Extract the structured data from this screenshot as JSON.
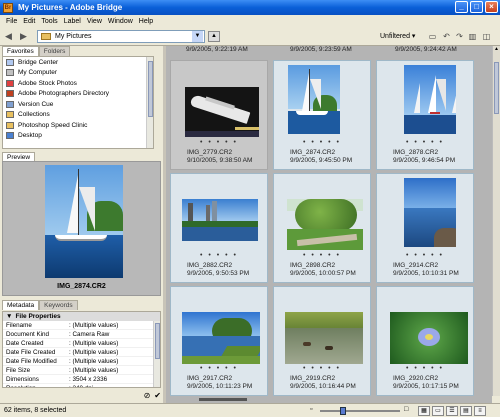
{
  "window": {
    "title": "My Pictures - Adobe Bridge",
    "controls": [
      "_",
      "□",
      "×"
    ]
  },
  "menu": [
    "File",
    "Edit",
    "Tools",
    "Label",
    "View",
    "Window",
    "Help"
  ],
  "toolbar": {
    "path": "My Pictures",
    "filter": "Unfiltered ▾"
  },
  "panels": {
    "favorites_tabs": [
      "Favorites",
      "Folders"
    ],
    "favorites": [
      {
        "label": "Bridge Center",
        "color": "#b0c8f0"
      },
      {
        "label": "My Computer",
        "color": "#c0c0c0"
      },
      {
        "label": "Adobe Stock Photos",
        "color": "#e04040"
      },
      {
        "label": "Adobe Photographers Directory",
        "color": "#c04020"
      },
      {
        "label": "Version Cue",
        "color": "#80a0d0"
      },
      {
        "label": "Collections",
        "color": "#e8c060"
      },
      {
        "label": "Photoshop Speed Clinic",
        "color": "#e8c060"
      },
      {
        "label": "Desktop",
        "color": "#4a80d0"
      }
    ],
    "preview_tab": "Preview",
    "preview_caption": "IMG_2874.CR2",
    "metadata_tabs": [
      "Metadata",
      "Keywords"
    ],
    "metadata_section": "File Properties",
    "metadata": [
      {
        "key": "Filename",
        "value": ": (Multiple values)"
      },
      {
        "key": "Document Kind",
        "value": ": Camera Raw"
      },
      {
        "key": "Date Created",
        "value": ": (Multiple values)"
      },
      {
        "key": "Date File Created",
        "value": ": (Multiple values)"
      },
      {
        "key": "Date File Modified",
        "value": ": (Multiple values)"
      },
      {
        "key": "File Size",
        "value": ": (Multiple values)"
      },
      {
        "key": "Dimensions",
        "value": ": 3504 x 2336"
      },
      {
        "key": "Resolution",
        "value": ": 240 dpi"
      }
    ]
  },
  "top_row_dates": [
    "9/9/2005, 9:22:19 AM",
    "9/9/2005, 9:23:59 AM",
    "9/9/2005, 9:24:42 AM"
  ],
  "thumbnails": [
    {
      "name": "IMG_2779.CR2",
      "date": "9/10/2005, 9:38:50 AM",
      "selected": false,
      "scene": "cruise"
    },
    {
      "name": "IMG_2874.CR2",
      "date": "9/9/2005, 9:45:50 PM",
      "selected": true,
      "scene": "sailboat"
    },
    {
      "name": "IMG_2878.CR2",
      "date": "9/9/2005, 9:46:54 PM",
      "selected": true,
      "scene": "sailboats"
    },
    {
      "name": "IMG_2882.CR2",
      "date": "9/9/2005, 9:50:53 PM",
      "selected": true,
      "scene": "skyline"
    },
    {
      "name": "IMG_2898.CR2",
      "date": "9/9/2005, 10:00:57 PM",
      "selected": true,
      "scene": "park"
    },
    {
      "name": "IMG_2914.CR2",
      "date": "9/9/2005, 10:10:31 PM",
      "selected": true,
      "scene": "rocks"
    },
    {
      "name": "IMG_2917.CR2",
      "date": "9/9/2005, 10:11:23 PM",
      "selected": true,
      "scene": "riverbank"
    },
    {
      "name": "IMG_2919.CR2",
      "date": "9/9/2005, 10:16:44 PM",
      "selected": true,
      "scene": "ducks"
    },
    {
      "name": "IMG_2920.CR2",
      "date": "9/9/2005, 10:17:15 PM",
      "selected": true,
      "scene": "flower"
    }
  ],
  "status": {
    "text": "62 items, 8 selected"
  }
}
